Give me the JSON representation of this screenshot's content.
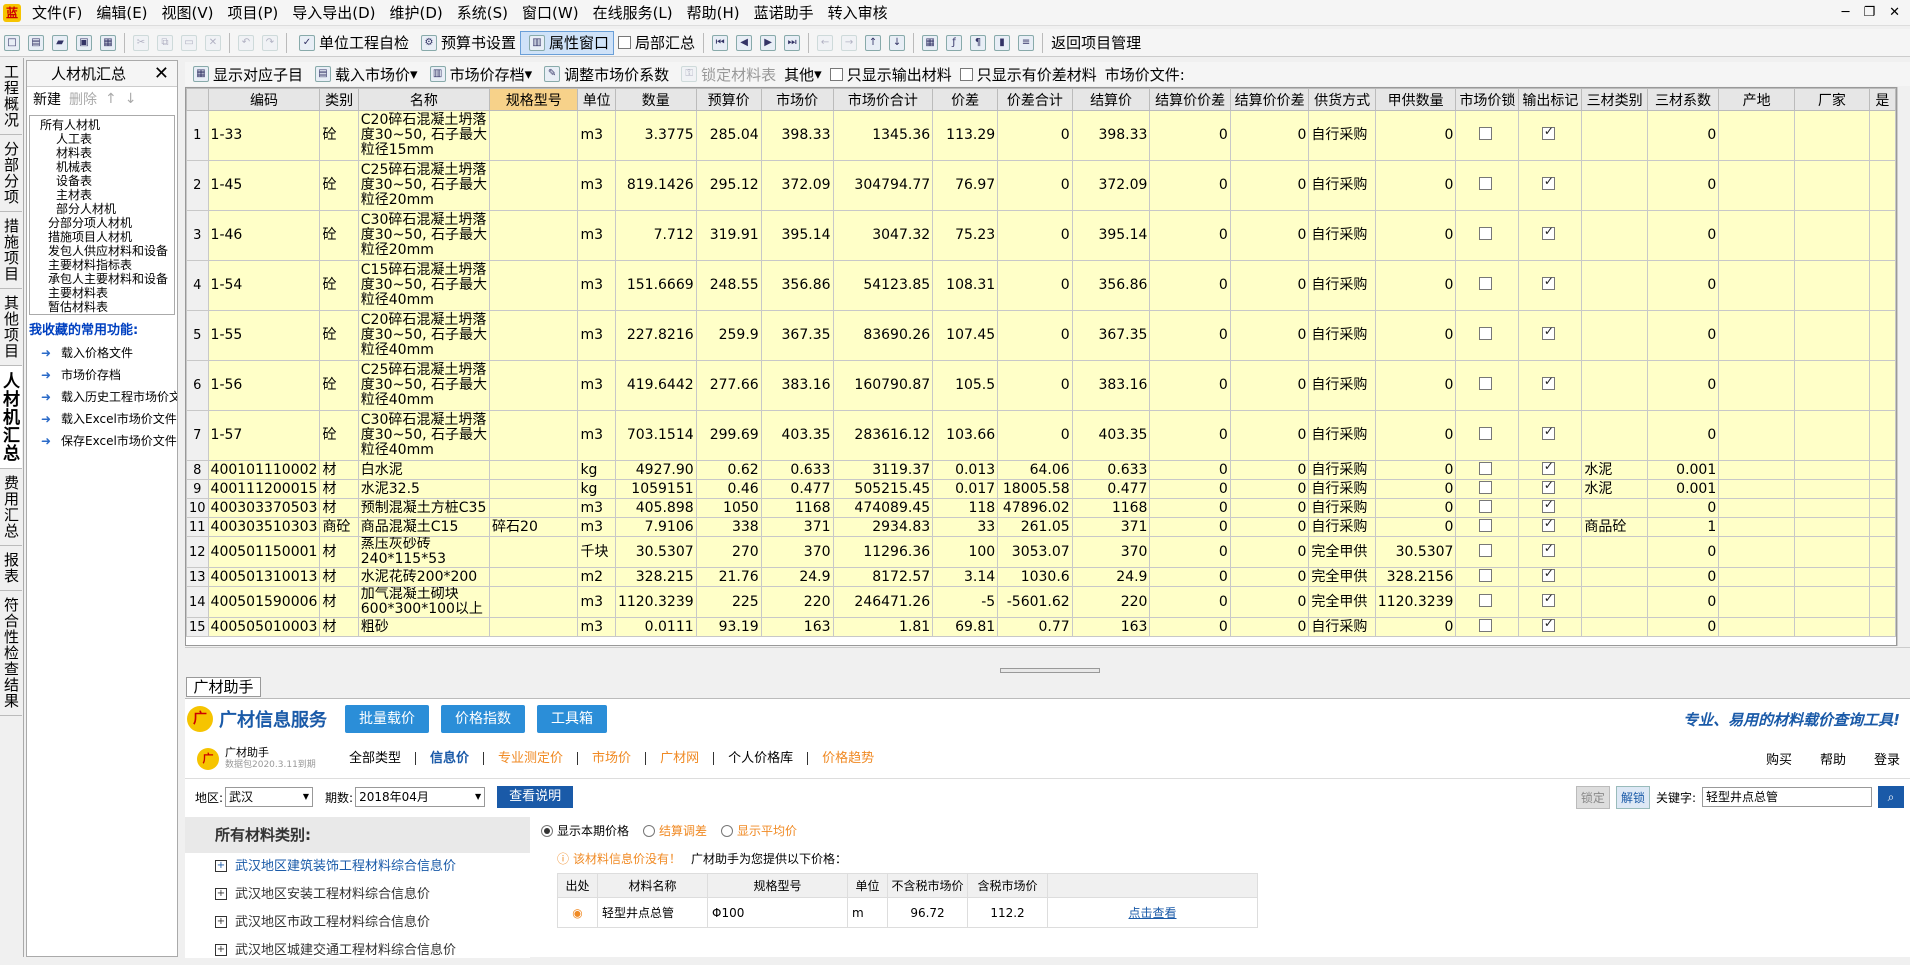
{
  "menubar": [
    "文件(F)",
    "编辑(E)",
    "视图(V)",
    "项目(P)",
    "导入导出(D)",
    "维护(D)",
    "系统(S)",
    "窗口(W)",
    "在线服务(L)",
    "帮助(H)",
    "蓝诺助手",
    "转入审核"
  ],
  "toolbar1": {
    "unit_check": "单位工程自检",
    "budget_settings": "预算书设置",
    "property_window": "属性窗口",
    "local_summary": "局部汇总",
    "return_mgmt": "返回项目管理"
  },
  "vtabs": [
    "工程概况",
    "分部分项",
    "措施项目",
    "其他项目",
    "人材机汇总",
    "费用汇总",
    "报表",
    "符合性检查结果"
  ],
  "leftpanel": {
    "title": "人材机汇总",
    "close": "✕",
    "new": "新建",
    "delete": "删除",
    "tree": [
      "所有人材机",
      "人工表",
      "材料表",
      "机械表",
      "设备表",
      "主材表",
      "部分人材机",
      "分部分项人材机",
      "措施项目人材机",
      "发包人供应材料和设备",
      "主要材料指标表",
      "承包人主要材料和设备",
      "主要材料表",
      "暂估材料表"
    ],
    "fav_title": "我收藏的常用功能:",
    "favs": [
      "载入价格文件",
      "市场价存档",
      "载入历史工程市场价文",
      "载入Excel市场价文件",
      "保存Excel市场价文件"
    ]
  },
  "toolbar2": {
    "show_sub": "显示对应子目",
    "load_price": "载入市场价",
    "archive": "市场价存档",
    "adjust": "调整市场价系数",
    "lock": "锁定材料表",
    "other": "其他",
    "only_output": "只显示输出材料",
    "only_diff": "只显示有价差材料",
    "price_file": "市场价文件:"
  },
  "grid": {
    "columns": [
      "",
      "编码",
      "类别",
      "名称",
      "规格型号",
      "单位",
      "数量",
      "预算价",
      "市场价",
      "市场价合计",
      "价差",
      "价差合计",
      "结算价",
      "结算价价差",
      "结算价价差",
      "供货方式",
      "甲供数量",
      "市场价锁",
      "输出标记",
      "三材类别",
      "三材系数",
      "产地",
      "厂家",
      "是"
    ],
    "rows": [
      [
        "1",
        "1-33",
        "砼",
        "C20碎石混凝土坍落度30~50, 石子最大粒径15mm",
        "",
        "m3",
        "3.3775",
        "285.04",
        "398.33",
        "1345.36",
        "113.29",
        "0",
        "398.33",
        "0",
        "0",
        "自行采购",
        "0",
        false,
        true,
        "",
        "0",
        "",
        ""
      ],
      [
        "2",
        "1-45",
        "砼",
        "C25碎石混凝土坍落度30~50, 石子最大粒径20mm",
        "",
        "m3",
        "819.1426",
        "295.12",
        "372.09",
        "304794.77",
        "76.97",
        "0",
        "372.09",
        "0",
        "0",
        "自行采购",
        "0",
        false,
        true,
        "",
        "0",
        "",
        ""
      ],
      [
        "3",
        "1-46",
        "砼",
        "C30碎石混凝土坍落度30~50, 石子最大粒径20mm",
        "",
        "m3",
        "7.712",
        "319.91",
        "395.14",
        "3047.32",
        "75.23",
        "0",
        "395.14",
        "0",
        "0",
        "自行采购",
        "0",
        false,
        true,
        "",
        "0",
        "",
        ""
      ],
      [
        "4",
        "1-54",
        "砼",
        "C15碎石混凝土坍落度30~50, 石子最大粒径40mm",
        "",
        "m3",
        "151.6669",
        "248.55",
        "356.86",
        "54123.85",
        "108.31",
        "0",
        "356.86",
        "0",
        "0",
        "自行采购",
        "0",
        false,
        true,
        "",
        "0",
        "",
        ""
      ],
      [
        "5",
        "1-55",
        "砼",
        "C20碎石混凝土坍落度30~50, 石子最大粒径40mm",
        "",
        "m3",
        "227.8216",
        "259.9",
        "367.35",
        "83690.26",
        "107.45",
        "0",
        "367.35",
        "0",
        "0",
        "自行采购",
        "0",
        false,
        true,
        "",
        "0",
        "",
        ""
      ],
      [
        "6",
        "1-56",
        "砼",
        "C25碎石混凝土坍落度30~50, 石子最大粒径40mm",
        "",
        "m3",
        "419.6442",
        "277.66",
        "383.16",
        "160790.87",
        "105.5",
        "0",
        "383.16",
        "0",
        "0",
        "自行采购",
        "0",
        false,
        true,
        "",
        "0",
        "",
        ""
      ],
      [
        "7",
        "1-57",
        "砼",
        "C30碎石混凝土坍落度30~50, 石子最大粒径40mm",
        "",
        "m3",
        "703.1514",
        "299.69",
        "403.35",
        "283616.12",
        "103.66",
        "0",
        "403.35",
        "0",
        "0",
        "自行采购",
        "0",
        false,
        true,
        "",
        "0",
        "",
        ""
      ],
      [
        "8",
        "400101110002",
        "材",
        "白水泥",
        "",
        "kg",
        "4927.90",
        "0.62",
        "0.633",
        "3119.37",
        "0.013",
        "64.06",
        "0.633",
        "0",
        "0",
        "自行采购",
        "0",
        false,
        true,
        "水泥",
        "0.001",
        "",
        ""
      ],
      [
        "9",
        "400111200015",
        "材",
        "水泥32.5",
        "",
        "kg",
        "1059151",
        "0.46",
        "0.477",
        "505215.45",
        "0.017",
        "18005.58",
        "0.477",
        "0",
        "0",
        "自行采购",
        "0",
        false,
        true,
        "水泥",
        "0.001",
        "",
        ""
      ],
      [
        "10",
        "400303370503",
        "材",
        "预制混凝土方桩C35",
        "",
        "m3",
        "405.898",
        "1050",
        "1168",
        "474089.45",
        "118",
        "47896.02",
        "1168",
        "0",
        "0",
        "自行采购",
        "0",
        false,
        true,
        "",
        "0",
        "",
        ""
      ],
      [
        "11",
        "400303510303",
        "商砼",
        "商品混凝土C15",
        "碎石20",
        "m3",
        "7.9106",
        "338",
        "371",
        "2934.83",
        "33",
        "261.05",
        "371",
        "0",
        "0",
        "自行采购",
        "0",
        false,
        true,
        "商品砼",
        "1",
        "",
        ""
      ],
      [
        "12",
        "400501150001",
        "材",
        "蒸压灰砂砖240*115*53",
        "",
        "千块",
        "30.5307",
        "270",
        "370",
        "11296.36",
        "100",
        "3053.07",
        "370",
        "0",
        "0",
        "完全甲供",
        "30.5307",
        false,
        true,
        "",
        "0",
        "",
        ""
      ],
      [
        "13",
        "400501310013",
        "材",
        "水泥花砖200*200",
        "",
        "m2",
        "328.215",
        "21.76",
        "24.9",
        "8172.57",
        "3.14",
        "1030.6",
        "24.9",
        "0",
        "0",
        "完全甲供",
        "328.2156",
        false,
        true,
        "",
        "0",
        "",
        ""
      ],
      [
        "14",
        "400501590006",
        "材",
        "加气混凝土砌块600*300*100以上",
        "",
        "m3",
        "1120.3239",
        "225",
        "220",
        "246471.26",
        "-5",
        "-5601.62",
        "220",
        "0",
        "0",
        "完全甲供",
        "1120.3239",
        false,
        true,
        "",
        "0",
        "",
        ""
      ],
      [
        "15",
        "400505010003",
        "材",
        "粗砂",
        "",
        "m3",
        "0.0111",
        "93.19",
        "163",
        "1.81",
        "69.81",
        "0.77",
        "163",
        "0",
        "0",
        "自行采购",
        "0",
        false,
        true,
        "",
        "0",
        "",
        ""
      ]
    ]
  },
  "guangcai": {
    "tab": "广材助手",
    "title": "广材信息服务",
    "btn_batch": "批量载价",
    "btn_index": "价格指数",
    "btn_tools": "工具箱",
    "slogan": "专业、易用的材料载价查询工具!",
    "user": "广材助手",
    "user_sub": "数据包2020.3.11到期",
    "nav": [
      "全部类型",
      "信息价",
      "专业测定价",
      "市场价",
      "广材网",
      "个人价格库",
      "价格趋势"
    ],
    "nav_right": [
      "购买",
      "帮助",
      "登录"
    ],
    "region_label": "地区:",
    "region": "武汉",
    "period_label": "期数:",
    "period": "2018年04月",
    "explain": "查看说明",
    "lock": "锁定",
    "unlock": "解锁",
    "keyword_label": "关键字:",
    "keyword": "轻型井点总管",
    "side_title": "所有材料类别:",
    "categories": [
      "武汉地区建筑装饰工程材料综合信息价",
      "武汉地区安装工程材料综合信息价",
      "武汉地区市政工程材料综合信息价",
      "武汉地区城建交通工程材料综合信息价"
    ],
    "radios": [
      "显示本期价格",
      "结算调差",
      "显示平均价"
    ],
    "notice": "该材料信息价没有！",
    "notice2": "广材助手为您提供以下价格：",
    "res_cols": [
      "出处",
      "材料名称",
      "规格型号",
      "单位",
      "不含税市场价",
      "含税市场价",
      ""
    ],
    "res_row": [
      "轻型井点总管",
      "Φ100",
      "m",
      "96.72",
      "112.2",
      "点击查看"
    ]
  }
}
